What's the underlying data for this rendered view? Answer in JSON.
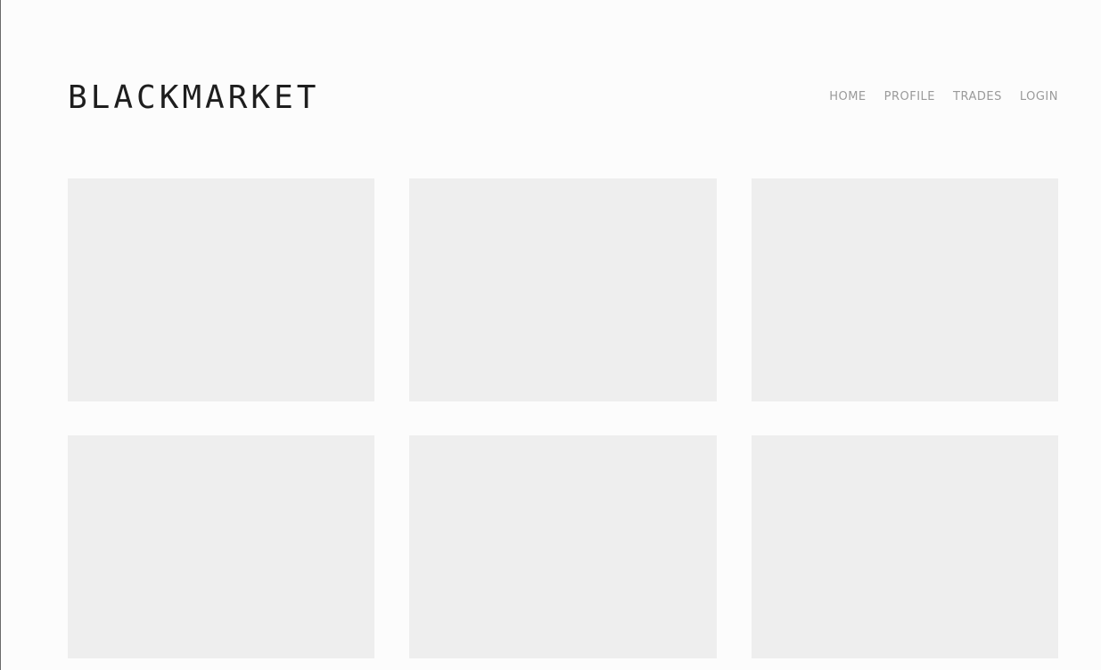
{
  "header": {
    "logo": "BLACKMARKET",
    "nav": [
      {
        "label": "HOME"
      },
      {
        "label": "PROFILE"
      },
      {
        "label": "TRADES"
      },
      {
        "label": "LOGIN"
      }
    ]
  },
  "main": {
    "tile_count": 6
  },
  "colors": {
    "background": "#fcfcfc",
    "tile": "#eeeeee",
    "logo": "#1e1e1e",
    "nav": "#9a9a9a"
  }
}
